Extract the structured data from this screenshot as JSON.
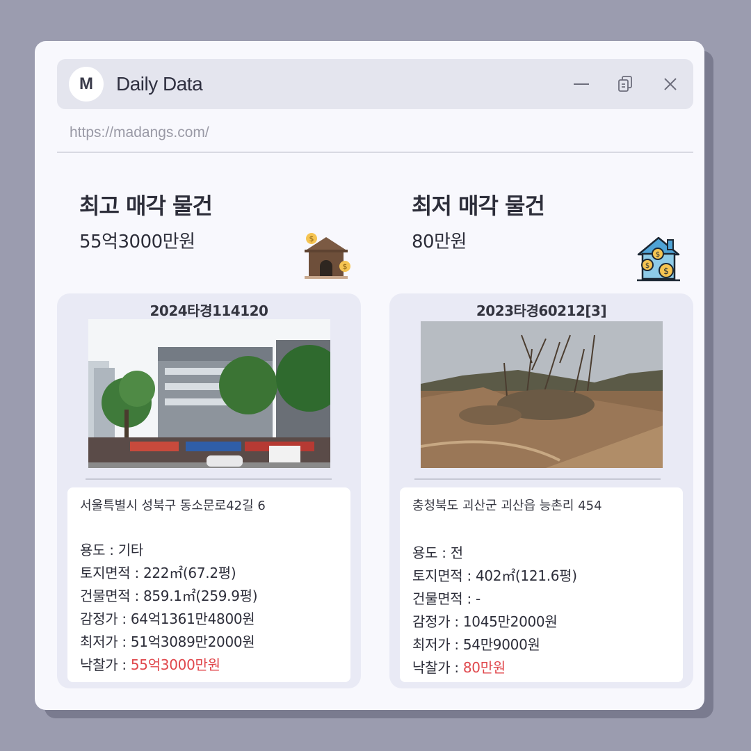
{
  "window": {
    "logo_letter": "M",
    "title": "Daily Data",
    "url": "https://madangs.com/"
  },
  "highest": {
    "heading": "최고 매각 물건",
    "price": "55억3000만원",
    "case_no": "2024타경114120",
    "address": "서울특별시 성북구 동소문로42길 6",
    "facts": [
      "용도 : 기타",
      "토지면적 : 222㎡(67.2평)",
      "건물면적 : 859.1㎡(259.9평)",
      "감정가 : 64억1361만4800원",
      "최저가 : 51억3089만2000원"
    ],
    "sold_label": "낙찰가 : ",
    "sold_value": "55억3000만원"
  },
  "lowest": {
    "heading": "최저 매각 물건",
    "price": "80만원",
    "case_no": "2023타경60212[3]",
    "address": "충청북도 괴산군 괴산읍 능촌리 454",
    "facts": [
      "용도 : 전",
      "토지면적 : 402㎡(121.6평)",
      "건물면적 : -",
      "감정가 : 1045만2000원",
      "최저가 : 54만9000원"
    ],
    "sold_label": "낙찰가 : ",
    "sold_value": "80만원"
  },
  "icons": {
    "high": "house-with-coins-icon",
    "low": "blue-house-with-coins-icon",
    "minimize": "minimize-icon",
    "copy": "copy-icon",
    "close": "close-icon"
  },
  "colors": {
    "sold_price": "#e0474c",
    "background": "#9b9caf",
    "card": "#e9eaf5"
  }
}
